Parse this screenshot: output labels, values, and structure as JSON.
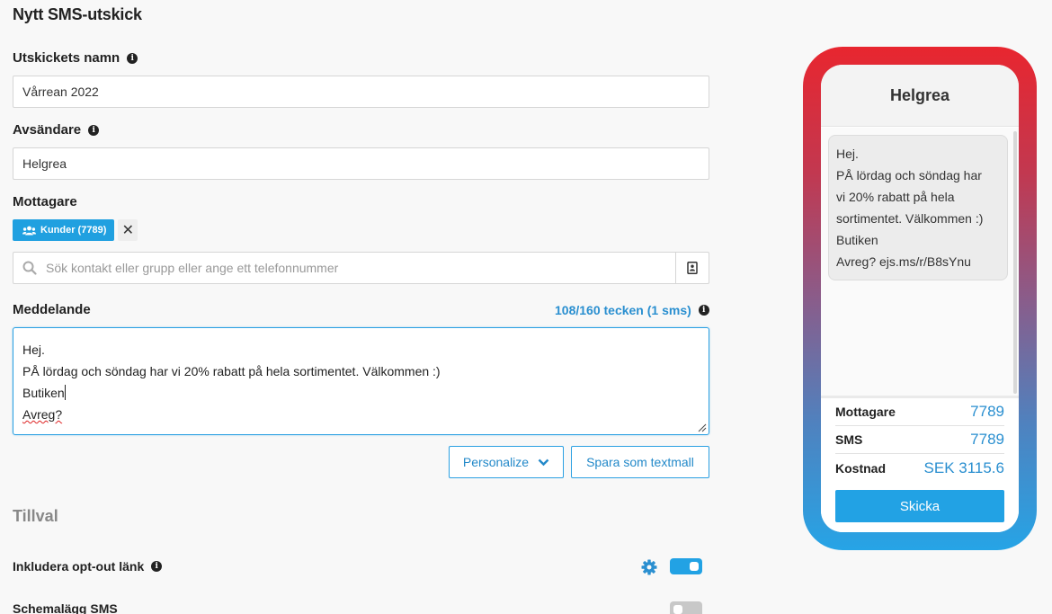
{
  "page": {
    "title": "Nytt SMS-utskick"
  },
  "form": {
    "name_label": "Utskickets namn",
    "name_value": "Vårrean 2022",
    "sender_label": "Avsändare",
    "sender_value": "Helgrea",
    "recipients_label": "Mottagare",
    "recipient_chip": "Kunder (7789)",
    "chip_remove": "✕",
    "search_placeholder": "Sök kontakt eller grupp eller ange ett telefonnummer",
    "message_label": "Meddelande",
    "char_count": "108/160 tecken (1 sms)",
    "message_lines": [
      "Hej.",
      "PÅ lördag och söndag har vi 20% rabatt på hela sortimentet. Välkommen :)",
      "Butiken",
      "Avreg?"
    ],
    "personalize_label": "Personalize",
    "save_template_label": "Spara som textmall"
  },
  "options": {
    "section_title": "Tillval",
    "optout_label": "Inkludera opt-out länk",
    "optout_enabled": true,
    "schedule_label": "Schemalägg SMS",
    "schedule_enabled": false
  },
  "preview": {
    "sender": "Helgrea",
    "message_lines": [
      "Hej.",
      "PÅ lördag och söndag har",
      "vi 20% rabatt på hela",
      "sortimentet. Välkommen :)",
      "Butiken",
      "Avreg? ejs.ms/r/B8sYnu"
    ],
    "stats": [
      {
        "label": "Mottagare",
        "value": "7789"
      },
      {
        "label": "SMS",
        "value": "7789"
      },
      {
        "label": "Kostnad",
        "value": "SEK 3115.6"
      }
    ],
    "send_label": "Skicka"
  },
  "colors": {
    "accent": "#2ba0e2",
    "toggle_on": "#22a2e4",
    "toggle_off": "#c8c8c8",
    "phone_gradient_top": "#e8262f",
    "phone_gradient_bottom": "#26a4e6"
  },
  "icons": {
    "info": "info-icon",
    "users": "users-icon",
    "search": "search-icon",
    "contacts": "contact-book-icon",
    "chevron": "chevron-down-icon",
    "settings": "gear-icon"
  }
}
